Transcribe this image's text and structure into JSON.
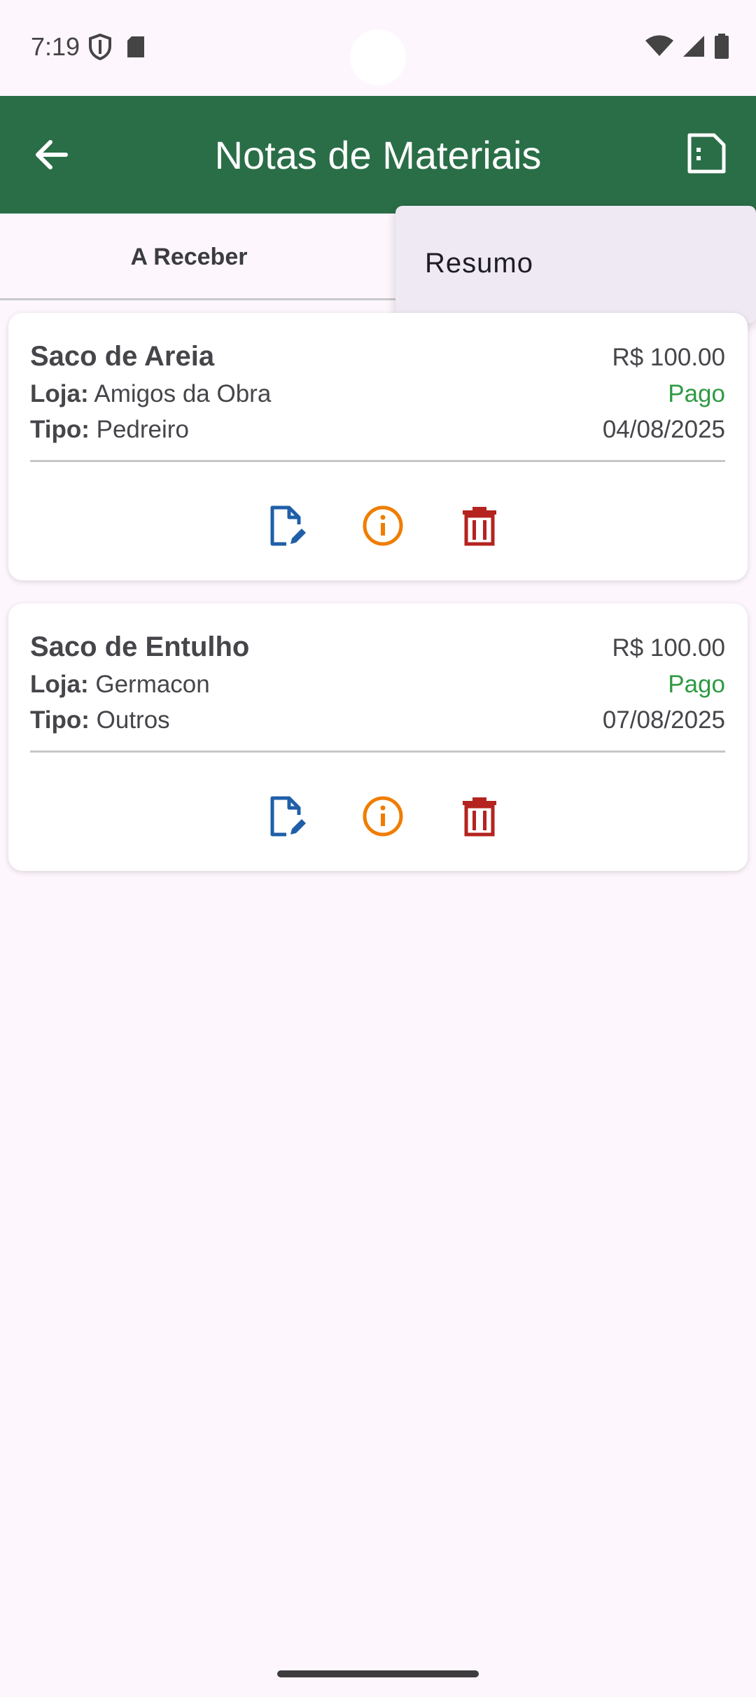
{
  "status_bar": {
    "time": "7:19",
    "left_icons": [
      "vpn-shield-icon",
      "sd-card-icon"
    ],
    "right_icons": [
      "wifi-icon",
      "signal-icon",
      "battery-icon"
    ]
  },
  "app_bar": {
    "title": "Notas de Materiais",
    "back_icon": "arrow-back-icon",
    "action_icon": "summary-document-icon",
    "color": "#2a6e47"
  },
  "tabs": [
    {
      "label": "A Receber",
      "selected": true
    }
  ],
  "popup_menu": {
    "items": [
      {
        "label": "Resumo"
      }
    ]
  },
  "cards": [
    {
      "title": "Saco de Areia",
      "value": "R$ 100.00",
      "store_label": "Loja:",
      "store": "Amigos da Obra",
      "type_label": "Tipo:",
      "type": "Pedreiro",
      "status": "Pago",
      "date": "04/08/2025"
    },
    {
      "title": "Saco de Entulho",
      "value": "R$ 100.00",
      "store_label": "Loja:",
      "store": "Germacon",
      "type_label": "Tipo:",
      "type": "Outros",
      "status": "Pago",
      "date": "07/08/2025"
    }
  ],
  "colors": {
    "status_paid": "#2f9a44",
    "edit_icon": "#1f5fa8",
    "info_icon": "#ef7d00",
    "delete_icon": "#b4231f"
  }
}
